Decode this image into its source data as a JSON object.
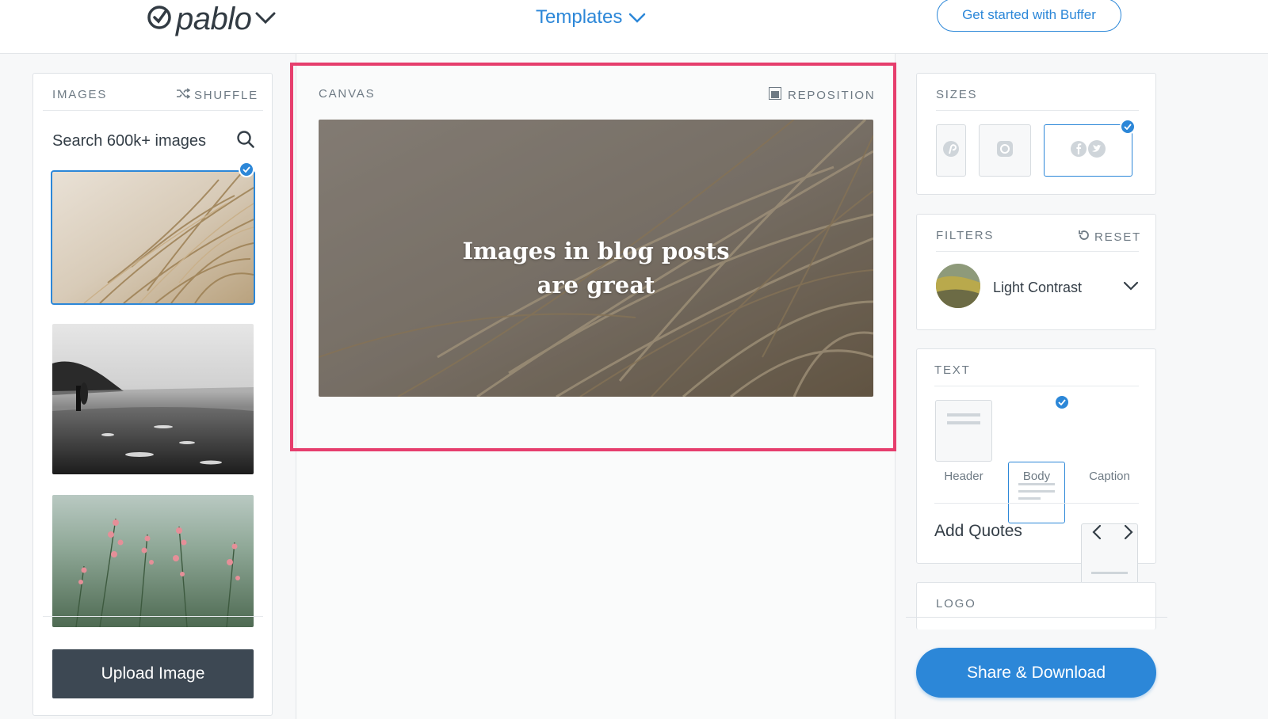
{
  "header": {
    "logo_text": "pablo",
    "templates_label": "Templates",
    "cta_label": "Get started with Buffer"
  },
  "images_panel": {
    "title": "IMAGES",
    "shuffle_label": "SHUFFLE",
    "search_placeholder": "Search 600k+ images",
    "upload_label": "Upload Image"
  },
  "canvas": {
    "title": "CANVAS",
    "reposition_label": "REPOSITION",
    "overlay_text": "Images in blog posts are great"
  },
  "sizes": {
    "title": "SIZES",
    "options": [
      "pinterest",
      "instagram",
      "facebook-twitter"
    ],
    "selected": "facebook-twitter"
  },
  "filters": {
    "title": "FILTERS",
    "reset_label": "RESET",
    "selected_filter": "Light Contrast"
  },
  "text_panel": {
    "title": "TEXT",
    "options": [
      "Header",
      "Body",
      "Caption"
    ],
    "selected": "Body",
    "add_quotes_label": "Add Quotes"
  },
  "logo_panel": {
    "title": "LOGO"
  },
  "share_label": "Share & Download",
  "colors": {
    "accent": "#2c87d8",
    "highlight": "#e63e6d",
    "dark_button": "#3d4853"
  }
}
